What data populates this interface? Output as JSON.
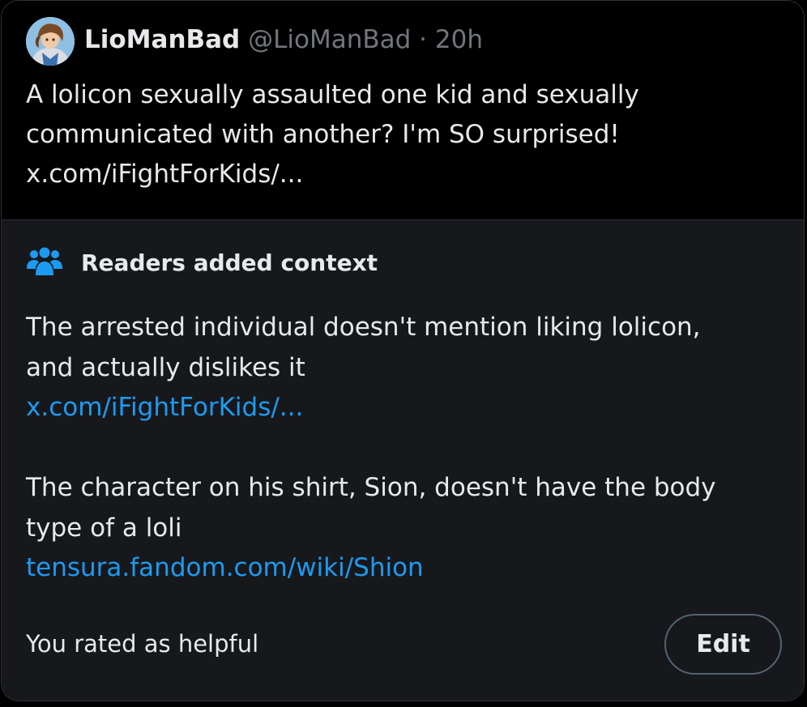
{
  "tweet": {
    "avatar_icon": "user-avatar-cartoon",
    "display_name": "LioManBad",
    "handle": "@LioManBad",
    "separator": "·",
    "timestamp": "20h",
    "text_lines": [
      "A lolicon sexually assaulted one kid and sexually",
      "communicated with another? I'm SO surprised!"
    ],
    "link": "x.com/iFightForKids/..."
  },
  "community_note": {
    "icon": "people-icon",
    "title": "Readers added context",
    "paragraph1_lines": [
      "The arrested individual doesn't mention liking lolicon,",
      "and actually dislikes it"
    ],
    "link1": "x.com/iFightForKids/...",
    "paragraph2_lines": [
      "The character on his shirt, Sion, doesn't have the body",
      "type of a loli"
    ],
    "link2": "tensura.fandom.com/wiki/Shion",
    "rating_status": "You rated as helpful",
    "edit_label": "Edit"
  },
  "colors": {
    "background": "#000000",
    "note_background": "#16181c",
    "text": "#e7e9ea",
    "secondary_text": "#71767b",
    "link": "#1d9bf0",
    "border": "#2f3336"
  }
}
